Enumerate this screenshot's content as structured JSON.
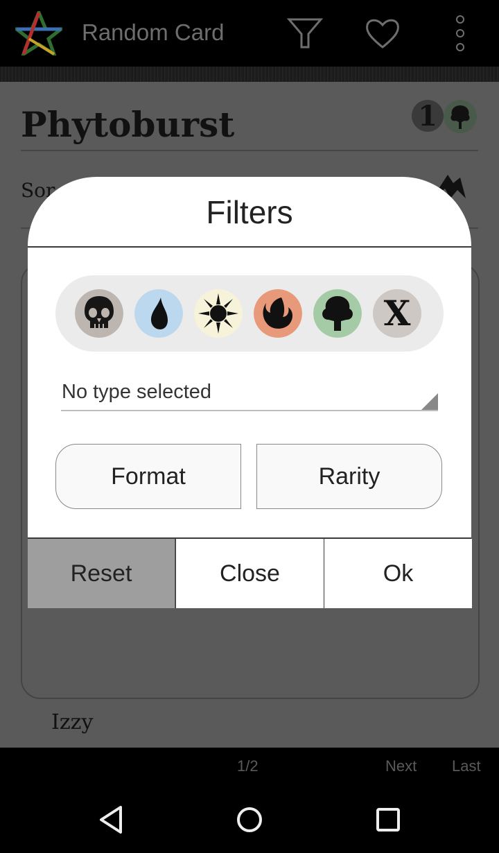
{
  "app_bar": {
    "title": "Random Card",
    "logo_icon": "pentagram-logo",
    "actions": [
      "filter-icon",
      "heart-icon",
      "overflow-menu-icon"
    ]
  },
  "card": {
    "name": "Phytoburst",
    "mana_cost_generic": "1",
    "mana_cost_color": "green",
    "type_line_partial": "Sor",
    "artist": "Izzy"
  },
  "pager": {
    "page": "1/2",
    "next": "Next",
    "last": "Last"
  },
  "dialog": {
    "title": "Filters",
    "colors": [
      {
        "name": "black",
        "bg": "#bdb5b0"
      },
      {
        "name": "blue",
        "bg": "#bcd8ee"
      },
      {
        "name": "white",
        "bg": "#f7f3da"
      },
      {
        "name": "red",
        "bg": "#e8997a"
      },
      {
        "name": "green",
        "bg": "#a4cba6"
      },
      {
        "name": "colorless",
        "bg": "#cdc8c4",
        "label": "X"
      }
    ],
    "type_select": "No type selected",
    "format_label": "Format",
    "rarity_label": "Rarity",
    "reset_label": "Reset",
    "close_label": "Close",
    "ok_label": "Ok"
  }
}
